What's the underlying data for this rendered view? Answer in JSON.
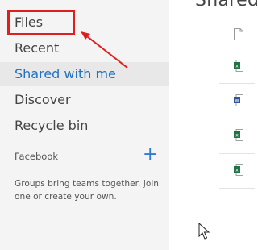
{
  "header": {
    "title_fragment": "Shared",
    "tiny_fragment": "y"
  },
  "sidebar": {
    "items": [
      {
        "label": "Files"
      },
      {
        "label": "Recent"
      },
      {
        "label": "Shared with me"
      },
      {
        "label": "Discover"
      },
      {
        "label": "Recycle bin"
      }
    ],
    "active_index": 2
  },
  "groups": {
    "header": "Facebook",
    "add_icon": "+",
    "info_text": "Groups bring teams together. Join one or create your own."
  },
  "files": [
    {
      "type": "generic"
    },
    {
      "type": "excel"
    },
    {
      "type": "word"
    },
    {
      "type": "excel"
    },
    {
      "type": "excel"
    }
  ],
  "colors": {
    "accent": "#1f72c2",
    "highlight": "#e01e1e",
    "excel": "#217346",
    "word": "#2b579a"
  }
}
